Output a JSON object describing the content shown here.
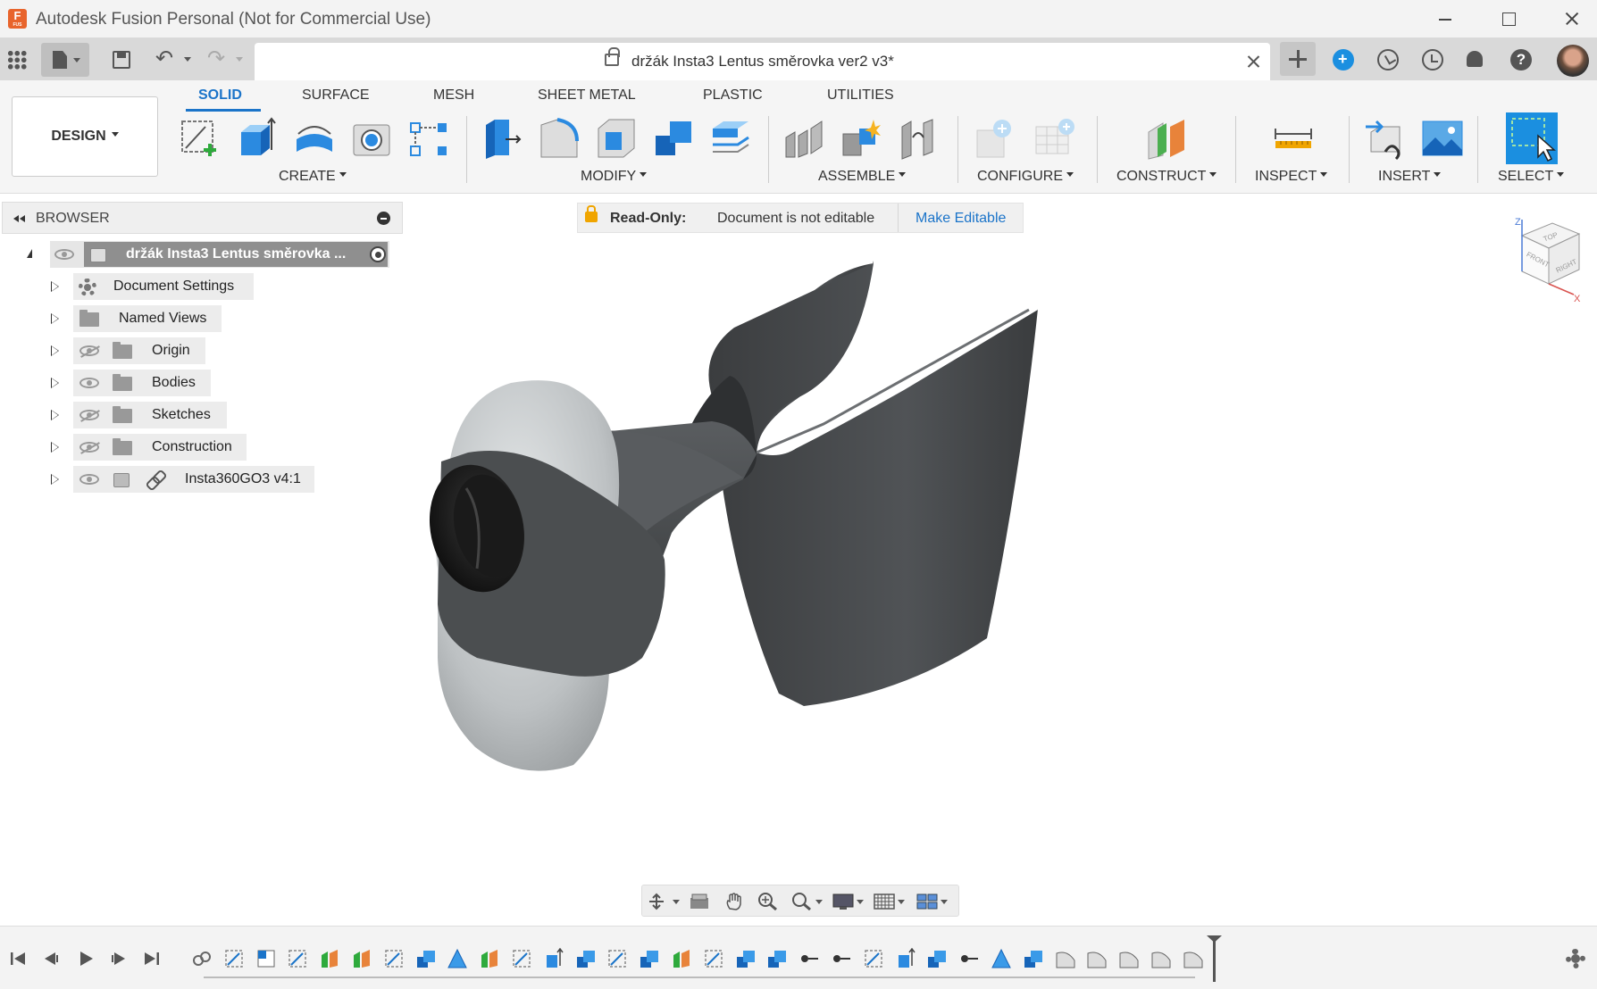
{
  "titlebar": {
    "app_title": "Autodesk Fusion Personal (Not for Commercial Use)"
  },
  "document_tab": {
    "title": "držák Insta3 Lentus směrovka ver2 v3*"
  },
  "workspace": {
    "label": "DESIGN"
  },
  "ribbon": {
    "tabs": [
      "SOLID",
      "SURFACE",
      "MESH",
      "SHEET METAL",
      "PLASTIC",
      "UTILITIES"
    ],
    "active_tab": "SOLID",
    "groups": [
      "CREATE",
      "MODIFY",
      "ASSEMBLE",
      "CONFIGURE",
      "CONSTRUCT",
      "INSPECT",
      "INSERT",
      "SELECT"
    ]
  },
  "browser": {
    "title": "BROWSER",
    "root": "držák Insta3 Lentus směrovka ...",
    "items": [
      {
        "label": "Document Settings",
        "icon": "gear-icon",
        "visibility": "none"
      },
      {
        "label": "Named Views",
        "icon": "folder-icon",
        "visibility": "none"
      },
      {
        "label": "Origin",
        "icon": "folder-icon",
        "visibility": "hidden"
      },
      {
        "label": "Bodies",
        "icon": "folder-icon",
        "visibility": "visible"
      },
      {
        "label": "Sketches",
        "icon": "folder-icon",
        "visibility": "hidden"
      },
      {
        "label": "Construction",
        "icon": "folder-icon",
        "visibility": "hidden"
      },
      {
        "label": "Insta360GO3 v4:1",
        "icon": "component-icon",
        "visibility": "visible"
      }
    ]
  },
  "readonly_banner": {
    "label": "Read-Only:",
    "message": "Document is not editable",
    "action": "Make Editable"
  },
  "viewcube": {
    "faces": [
      "TOP",
      "FRONT",
      "RIGHT"
    ],
    "axes": [
      "Z",
      "X"
    ]
  },
  "colors": {
    "accent": "#1b74c9",
    "brand": "#e8642c",
    "model_dark": "#4a4c4e",
    "model_light": "#c8cbcc",
    "lock_warning": "#f0a500"
  }
}
